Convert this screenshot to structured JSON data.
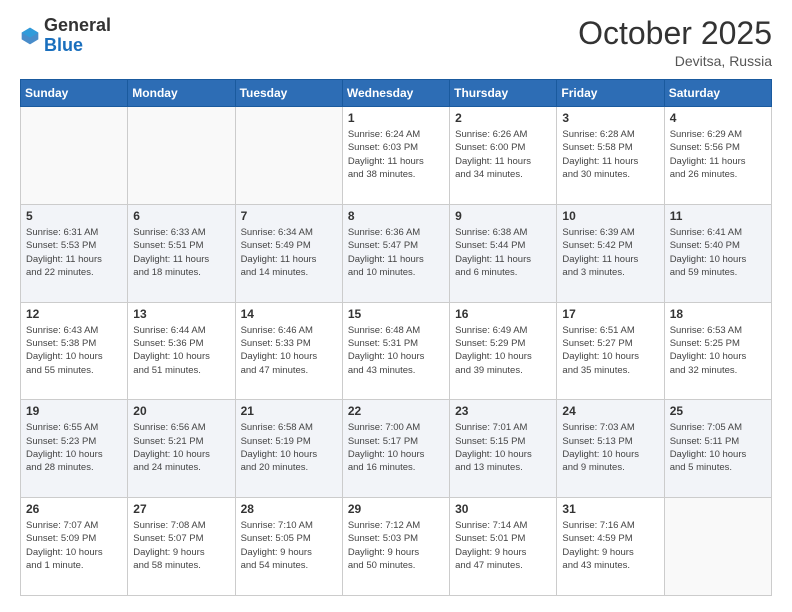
{
  "header": {
    "logo_general": "General",
    "logo_blue": "Blue",
    "month": "October 2025",
    "location": "Devitsa, Russia"
  },
  "days_of_week": [
    "Sunday",
    "Monday",
    "Tuesday",
    "Wednesday",
    "Thursday",
    "Friday",
    "Saturday"
  ],
  "weeks": [
    {
      "alt": false,
      "days": [
        {
          "num": "",
          "info": ""
        },
        {
          "num": "",
          "info": ""
        },
        {
          "num": "",
          "info": ""
        },
        {
          "num": "1",
          "info": "Sunrise: 6:24 AM\nSunset: 6:03 PM\nDaylight: 11 hours\nand 38 minutes."
        },
        {
          "num": "2",
          "info": "Sunrise: 6:26 AM\nSunset: 6:00 PM\nDaylight: 11 hours\nand 34 minutes."
        },
        {
          "num": "3",
          "info": "Sunrise: 6:28 AM\nSunset: 5:58 PM\nDaylight: 11 hours\nand 30 minutes."
        },
        {
          "num": "4",
          "info": "Sunrise: 6:29 AM\nSunset: 5:56 PM\nDaylight: 11 hours\nand 26 minutes."
        }
      ]
    },
    {
      "alt": true,
      "days": [
        {
          "num": "5",
          "info": "Sunrise: 6:31 AM\nSunset: 5:53 PM\nDaylight: 11 hours\nand 22 minutes."
        },
        {
          "num": "6",
          "info": "Sunrise: 6:33 AM\nSunset: 5:51 PM\nDaylight: 11 hours\nand 18 minutes."
        },
        {
          "num": "7",
          "info": "Sunrise: 6:34 AM\nSunset: 5:49 PM\nDaylight: 11 hours\nand 14 minutes."
        },
        {
          "num": "8",
          "info": "Sunrise: 6:36 AM\nSunset: 5:47 PM\nDaylight: 11 hours\nand 10 minutes."
        },
        {
          "num": "9",
          "info": "Sunrise: 6:38 AM\nSunset: 5:44 PM\nDaylight: 11 hours\nand 6 minutes."
        },
        {
          "num": "10",
          "info": "Sunrise: 6:39 AM\nSunset: 5:42 PM\nDaylight: 11 hours\nand 3 minutes."
        },
        {
          "num": "11",
          "info": "Sunrise: 6:41 AM\nSunset: 5:40 PM\nDaylight: 10 hours\nand 59 minutes."
        }
      ]
    },
    {
      "alt": false,
      "days": [
        {
          "num": "12",
          "info": "Sunrise: 6:43 AM\nSunset: 5:38 PM\nDaylight: 10 hours\nand 55 minutes."
        },
        {
          "num": "13",
          "info": "Sunrise: 6:44 AM\nSunset: 5:36 PM\nDaylight: 10 hours\nand 51 minutes."
        },
        {
          "num": "14",
          "info": "Sunrise: 6:46 AM\nSunset: 5:33 PM\nDaylight: 10 hours\nand 47 minutes."
        },
        {
          "num": "15",
          "info": "Sunrise: 6:48 AM\nSunset: 5:31 PM\nDaylight: 10 hours\nand 43 minutes."
        },
        {
          "num": "16",
          "info": "Sunrise: 6:49 AM\nSunset: 5:29 PM\nDaylight: 10 hours\nand 39 minutes."
        },
        {
          "num": "17",
          "info": "Sunrise: 6:51 AM\nSunset: 5:27 PM\nDaylight: 10 hours\nand 35 minutes."
        },
        {
          "num": "18",
          "info": "Sunrise: 6:53 AM\nSunset: 5:25 PM\nDaylight: 10 hours\nand 32 minutes."
        }
      ]
    },
    {
      "alt": true,
      "days": [
        {
          "num": "19",
          "info": "Sunrise: 6:55 AM\nSunset: 5:23 PM\nDaylight: 10 hours\nand 28 minutes."
        },
        {
          "num": "20",
          "info": "Sunrise: 6:56 AM\nSunset: 5:21 PM\nDaylight: 10 hours\nand 24 minutes."
        },
        {
          "num": "21",
          "info": "Sunrise: 6:58 AM\nSunset: 5:19 PM\nDaylight: 10 hours\nand 20 minutes."
        },
        {
          "num": "22",
          "info": "Sunrise: 7:00 AM\nSunset: 5:17 PM\nDaylight: 10 hours\nand 16 minutes."
        },
        {
          "num": "23",
          "info": "Sunrise: 7:01 AM\nSunset: 5:15 PM\nDaylight: 10 hours\nand 13 minutes."
        },
        {
          "num": "24",
          "info": "Sunrise: 7:03 AM\nSunset: 5:13 PM\nDaylight: 10 hours\nand 9 minutes."
        },
        {
          "num": "25",
          "info": "Sunrise: 7:05 AM\nSunset: 5:11 PM\nDaylight: 10 hours\nand 5 minutes."
        }
      ]
    },
    {
      "alt": false,
      "days": [
        {
          "num": "26",
          "info": "Sunrise: 7:07 AM\nSunset: 5:09 PM\nDaylight: 10 hours\nand 1 minute."
        },
        {
          "num": "27",
          "info": "Sunrise: 7:08 AM\nSunset: 5:07 PM\nDaylight: 9 hours\nand 58 minutes."
        },
        {
          "num": "28",
          "info": "Sunrise: 7:10 AM\nSunset: 5:05 PM\nDaylight: 9 hours\nand 54 minutes."
        },
        {
          "num": "29",
          "info": "Sunrise: 7:12 AM\nSunset: 5:03 PM\nDaylight: 9 hours\nand 50 minutes."
        },
        {
          "num": "30",
          "info": "Sunrise: 7:14 AM\nSunset: 5:01 PM\nDaylight: 9 hours\nand 47 minutes."
        },
        {
          "num": "31",
          "info": "Sunrise: 7:16 AM\nSunset: 4:59 PM\nDaylight: 9 hours\nand 43 minutes."
        },
        {
          "num": "",
          "info": ""
        }
      ]
    }
  ]
}
